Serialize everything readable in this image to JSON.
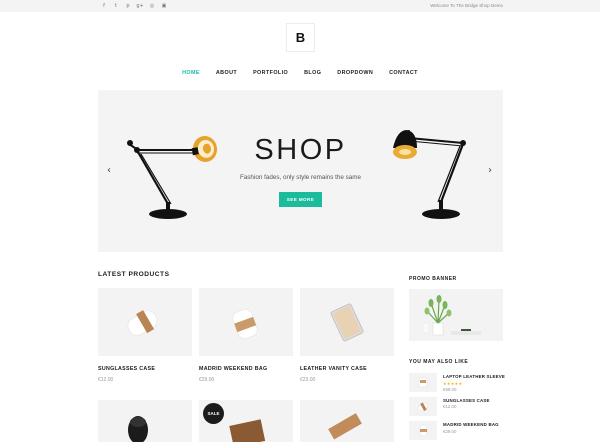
{
  "topbar": {
    "social_icons": [
      {
        "name": "facebook-icon",
        "glyph": "f"
      },
      {
        "name": "twitter-icon",
        "glyph": "t"
      },
      {
        "name": "pinterest-icon",
        "glyph": "p"
      },
      {
        "name": "google-plus-icon",
        "glyph": "g+"
      },
      {
        "name": "dribbble-icon",
        "glyph": "◎"
      },
      {
        "name": "instagram-icon",
        "glyph": "▣"
      }
    ],
    "welcome": "Welcome To The Bridge Shop Demo"
  },
  "logo": {
    "letter": "B"
  },
  "nav": {
    "items": [
      "HOME",
      "ABOUT",
      "PORTFOLIO",
      "BLOG",
      "DROPDOWN",
      "CONTACT"
    ],
    "active": "HOME"
  },
  "hero": {
    "title": "SHOP",
    "subtitle": "Fashion fades, only style remains the same",
    "button": "SEE MORE",
    "prev_glyph": "‹",
    "next_glyph": "›"
  },
  "products": {
    "heading": "LATEST PRODUCTS",
    "items": [
      {
        "name": "SUNGLASSES CASE",
        "price": "€12.00"
      },
      {
        "name": "MADRID WEEKEND BAG",
        "price": "€29.00"
      },
      {
        "name": "LEATHER VANITY CASE",
        "price": "€23.00"
      }
    ],
    "sale_badge": "SALE"
  },
  "sidebar": {
    "promo_heading": "PROMO BANNER",
    "like_heading": "YOU MAY ALSO LIKE",
    "items": [
      {
        "name": "LAPTOP LEATHER SLEEVE",
        "price": "€59.00",
        "stars": "★★★★★"
      },
      {
        "name": "SUNGLASSES CASE",
        "price": "€12.00"
      },
      {
        "name": "MADRID WEEKEND BAG",
        "price": "€29.00"
      }
    ]
  },
  "colors": {
    "accent": "#1abc9c",
    "text": "#1b1b1b",
    "muted": "#999999",
    "panel": "#f4f4f4",
    "star": "#f5b301"
  }
}
